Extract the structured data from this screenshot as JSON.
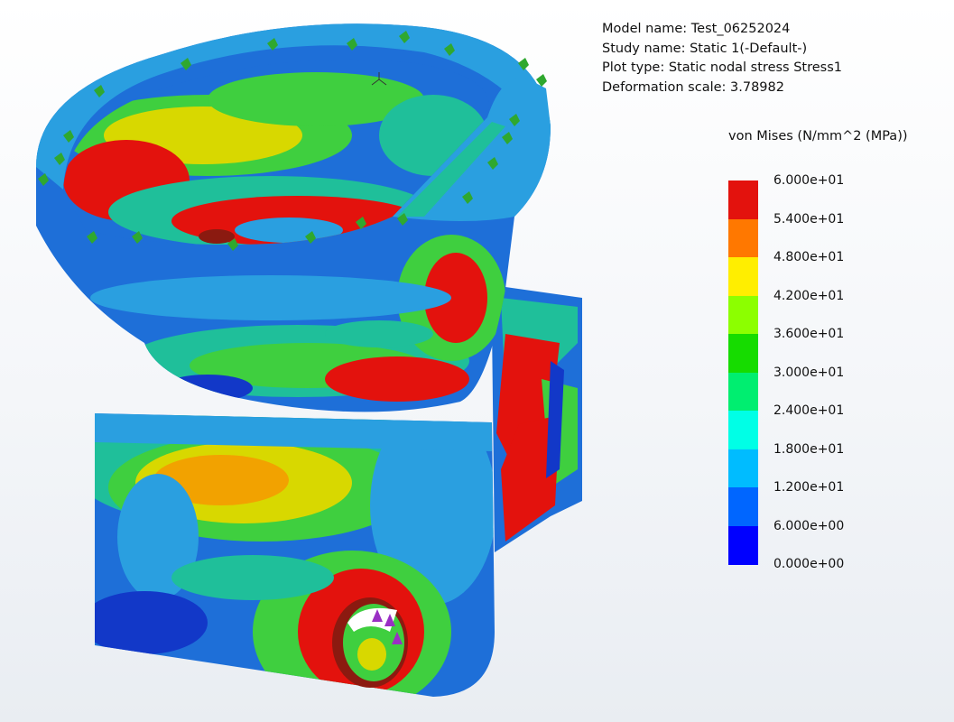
{
  "info": {
    "model_name": "Model name: Test_06252024",
    "study_name": "Study name: Static 1(-Default-)",
    "plot_type": "Plot type: Static nodal stress Stress1",
    "deformation_scale": "Deformation scale: 3.78982"
  },
  "legend": {
    "title": "von Mises (N/mm^2 (MPa))",
    "labels": [
      "6.000e+01",
      "5.400e+01",
      "4.800e+01",
      "4.200e+01",
      "3.600e+01",
      "3.000e+01",
      "2.400e+01",
      "1.800e+01",
      "1.200e+01",
      "6.000e+00",
      "0.000e+00"
    ],
    "colors": [
      "#e3120d",
      "#ff7800",
      "#ffee00",
      "#8cff00",
      "#16dc00",
      "#00ee70",
      "#00ffe6",
      "#00bcff",
      "#0066ff",
      "#0000ff"
    ]
  },
  "model_colors": {
    "red": "#e3120d",
    "orange": "#f2a200",
    "yellow": "#d8d800",
    "green": "#3fcf3f",
    "teal": "#1fbf9a",
    "lightblue": "#2a9fe0",
    "blue": "#1e6fd8",
    "darkblue": "#1238c8",
    "fixture": "#2fa82f",
    "load": "#9a2fc4"
  }
}
